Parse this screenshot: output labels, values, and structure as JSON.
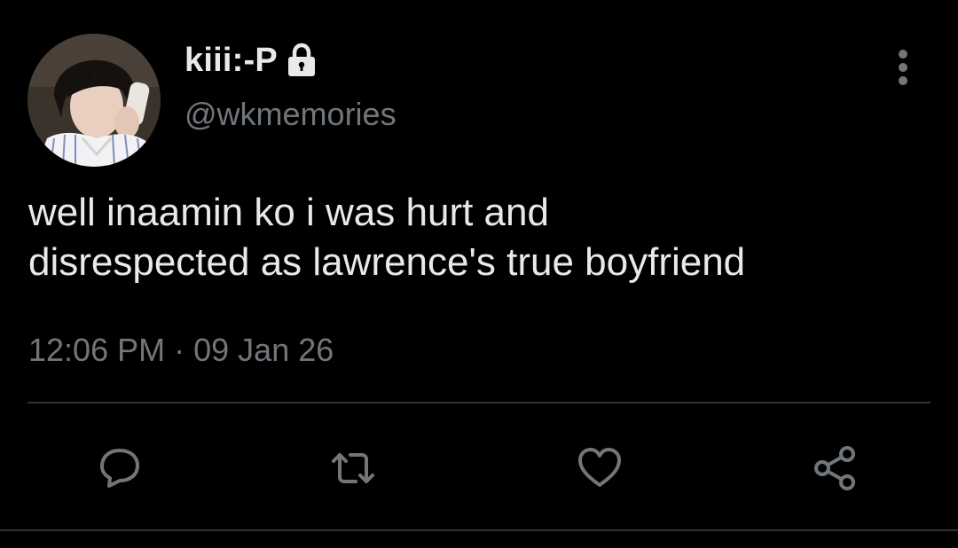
{
  "tweet": {
    "display_name": "kiii:-P",
    "handle": "@wkmemories",
    "text": "well inaamin ko i was hurt and\ndisrespected as lawrence's true boyfriend",
    "time": "12:06 PM",
    "date_separator": "·",
    "date": "09 Jan 26",
    "protected_icon": "lock-icon",
    "avatar_icon": "avatar-photo"
  },
  "actions": [
    {
      "name": "reply",
      "icon": "speech-bubble-icon"
    },
    {
      "name": "retweet",
      "icon": "retweet-arrows-icon"
    },
    {
      "name": "like",
      "icon": "heart-icon"
    },
    {
      "name": "share",
      "icon": "share-nodes-icon"
    }
  ],
  "colors": {
    "background": "#000000",
    "primary_text": "#e7e9ea",
    "secondary_text": "#71767b",
    "divider": "#2f3336"
  }
}
